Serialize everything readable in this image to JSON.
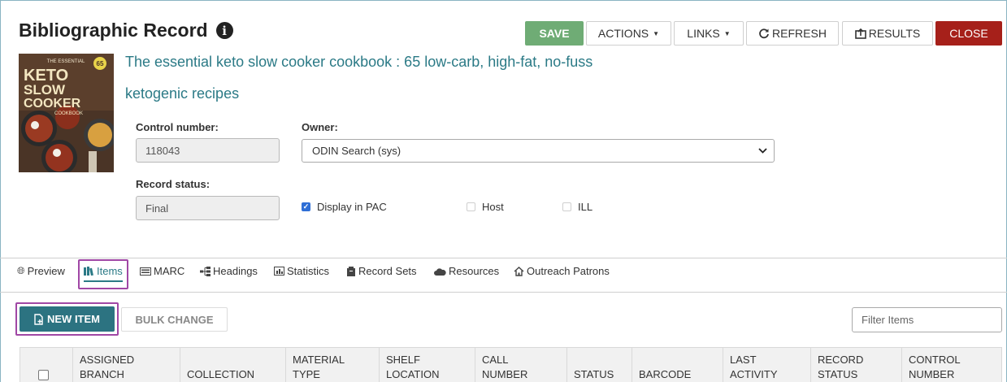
{
  "header": {
    "title": "Bibliographic Record",
    "info_icon": "info-circle-icon"
  },
  "toolbar": {
    "save": "SAVE",
    "actions": "ACTIONS",
    "links": "LINKS",
    "refresh": "REFRESH",
    "results": "RESULTS",
    "close": "CLOSE",
    "save_color": "#6fac75",
    "close_color": "#a6201a"
  },
  "cover": {
    "line1": "THE ESSENTIAL",
    "line2": "KETO",
    "line3": "SLOW",
    "line4": "COOKER",
    "line5": "COOKBOOK",
    "badge": "65"
  },
  "record": {
    "title_line1": "The essential keto slow cooker cookbook : 65 low-carb, high-fat, no-fuss",
    "title_line2": "ketogenic recipes"
  },
  "fields": {
    "control_number_label": "Control number:",
    "control_number_value": "118043",
    "owner_label": "Owner:",
    "owner_value": "ODIN Search (sys)",
    "record_status_label": "Record status:",
    "record_status_value": "Final",
    "display_in_pac_label": "Display in PAC",
    "display_in_pac_checked": true,
    "host_label": "Host",
    "host_checked": false,
    "ill_label": "ILL",
    "ill_checked": false
  },
  "tabs": [
    {
      "label": "Preview",
      "icon": "globe-icon"
    },
    {
      "label": "Items",
      "icon": "books-icon",
      "active": true
    },
    {
      "label": "MARC",
      "icon": "keyboard-icon"
    },
    {
      "label": "Headings",
      "icon": "sitemap-icon"
    },
    {
      "label": "Statistics",
      "icon": "bar-chart-icon"
    },
    {
      "label": "Record Sets",
      "icon": "archive-icon"
    },
    {
      "label": "Resources",
      "icon": "cloud-icon"
    },
    {
      "label": "Outreach Patrons",
      "icon": "home-icon"
    }
  ],
  "items": {
    "new_item": "NEW ITEM",
    "bulk_change": "BULK CHANGE",
    "filter_placeholder": "Filter Items",
    "columns": [
      [
        "ASSIGNED",
        "BRANCH"
      ],
      [
        "",
        "COLLECTION"
      ],
      [
        "MATERIAL",
        "TYPE"
      ],
      [
        "SHELF",
        "LOCATION"
      ],
      [
        "CALL",
        "NUMBER"
      ],
      [
        "",
        "STATUS"
      ],
      [
        "",
        "BARCODE"
      ],
      [
        "LAST",
        "ACTIVITY"
      ],
      [
        "RECORD",
        "STATUS"
      ],
      [
        "CONTROL",
        "NUMBER"
      ]
    ]
  }
}
